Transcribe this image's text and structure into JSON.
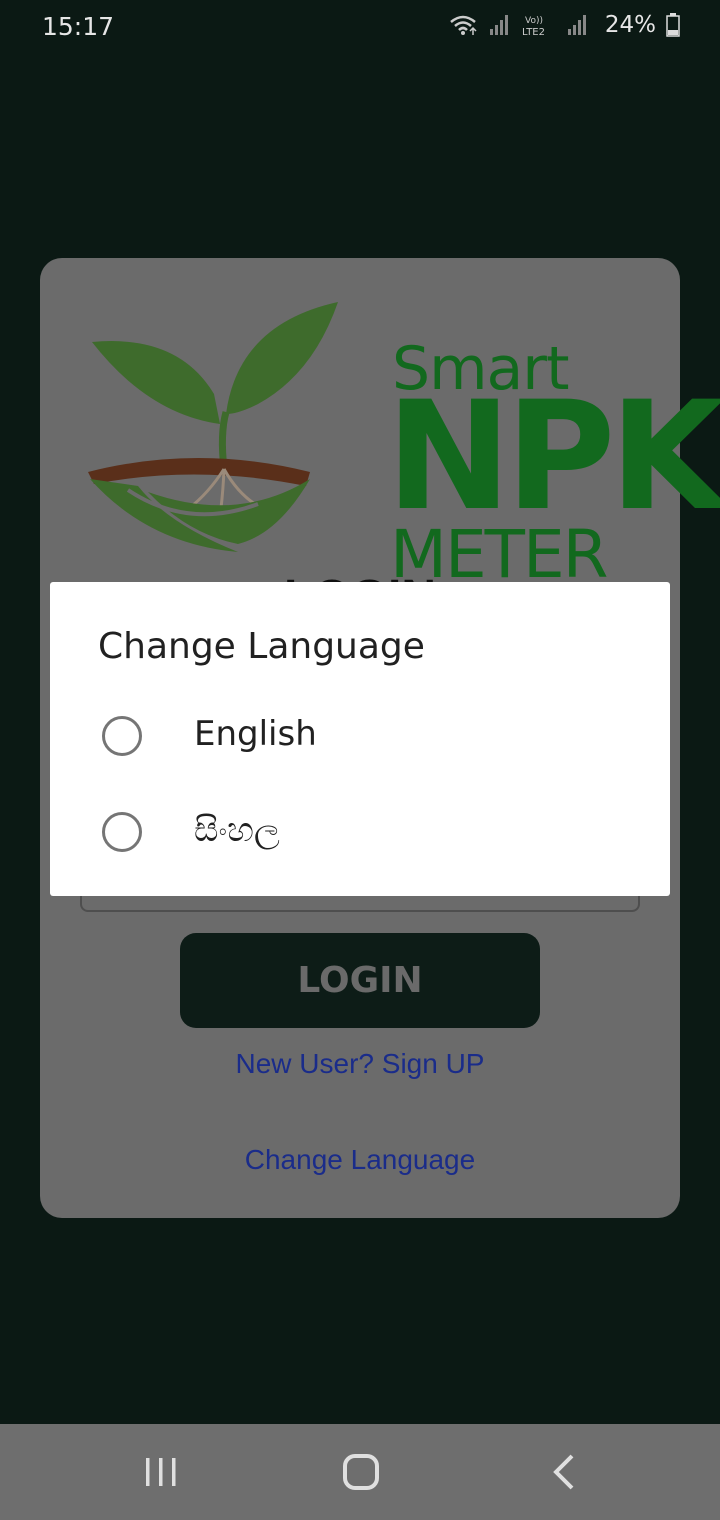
{
  "status_bar": {
    "time": "15:17",
    "battery": "24%",
    "icons": [
      "wifi-icon",
      "signal-icon",
      "volte-lte2-icon",
      "signal-icon",
      "battery-icon"
    ],
    "network_label_1": "Vo))",
    "network_label_2": "LTE2"
  },
  "logo": {
    "smart": "Smart",
    "npk": "NPK",
    "meter": "METER",
    "icon": "plant-sprout-icon"
  },
  "login_card": {
    "heading": "LOGIN",
    "login_button": "LOGIN",
    "signup_link": "New User? Sign UP",
    "change_language_link": "Change Language"
  },
  "dialog": {
    "title": "Change Language",
    "options": [
      {
        "label": "English",
        "selected": false
      },
      {
        "label": "සිංහල",
        "selected": false
      }
    ]
  },
  "nav_bar": {
    "buttons": [
      "recent-apps-icon",
      "home-icon",
      "back-icon"
    ]
  },
  "colors": {
    "background": "#0b1914",
    "card": "#6b6b6b",
    "brand_green": "#12691e",
    "link": "#1a2c8a",
    "button": "#0d1c17"
  }
}
